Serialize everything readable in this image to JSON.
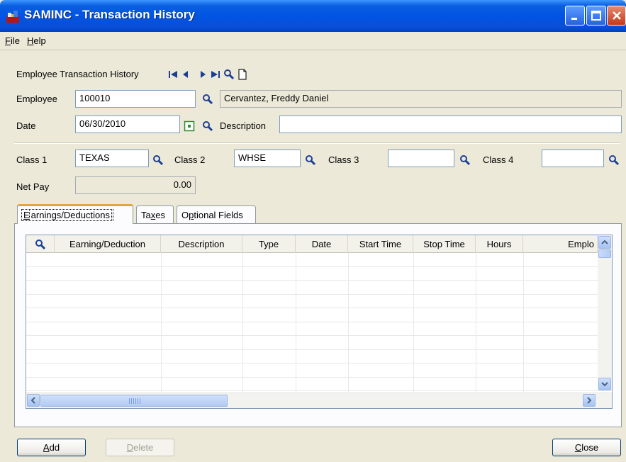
{
  "window": {
    "title": "SAMINC - Transaction History"
  },
  "menu": {
    "file_underline": "F",
    "file_rest": "ile",
    "help_underline": "H",
    "help_rest": "elp"
  },
  "header": {
    "nav_label": "Employee Transaction History"
  },
  "form": {
    "employee_label": "Employee",
    "employee_value": "100010",
    "employee_name": "Cervantez, Freddy Daniel",
    "date_label": "Date",
    "date_value": "06/30/2010",
    "description_label": "Description",
    "description_value": "",
    "class1_label": "Class 1",
    "class1_value": "TEXAS",
    "class2_label": "Class 2",
    "class2_value": "WHSE",
    "class3_label": "Class 3",
    "class3_value": "",
    "class4_label": "Class 4",
    "class4_value": "",
    "netpay_label": "Net Pay",
    "netpay_value": "0.00"
  },
  "tabs": [
    {
      "pre": "",
      "ul": "E",
      "post": "arnings/Deductions"
    },
    {
      "pre": "Ta",
      "ul": "x",
      "post": "es"
    },
    {
      "pre": "O",
      "ul": "p",
      "post": "tional Fields"
    }
  ],
  "grid": {
    "columns": [
      "Earning/Deduction",
      "Description",
      "Type",
      "Date",
      "Start Time",
      "Stop Time",
      "Hours",
      "Emplo"
    ]
  },
  "buttons": {
    "add_ul": "A",
    "add_rest": "dd",
    "delete_ul": "D",
    "delete_rest": "elete",
    "close_ul": "C",
    "close_rest": "lose"
  },
  "colors": {
    "titlebar": "#0054e3",
    "dialog_bg": "#ece9d8",
    "field_border": "#7f9db9",
    "tab_active_accent": "#e7a33f"
  }
}
